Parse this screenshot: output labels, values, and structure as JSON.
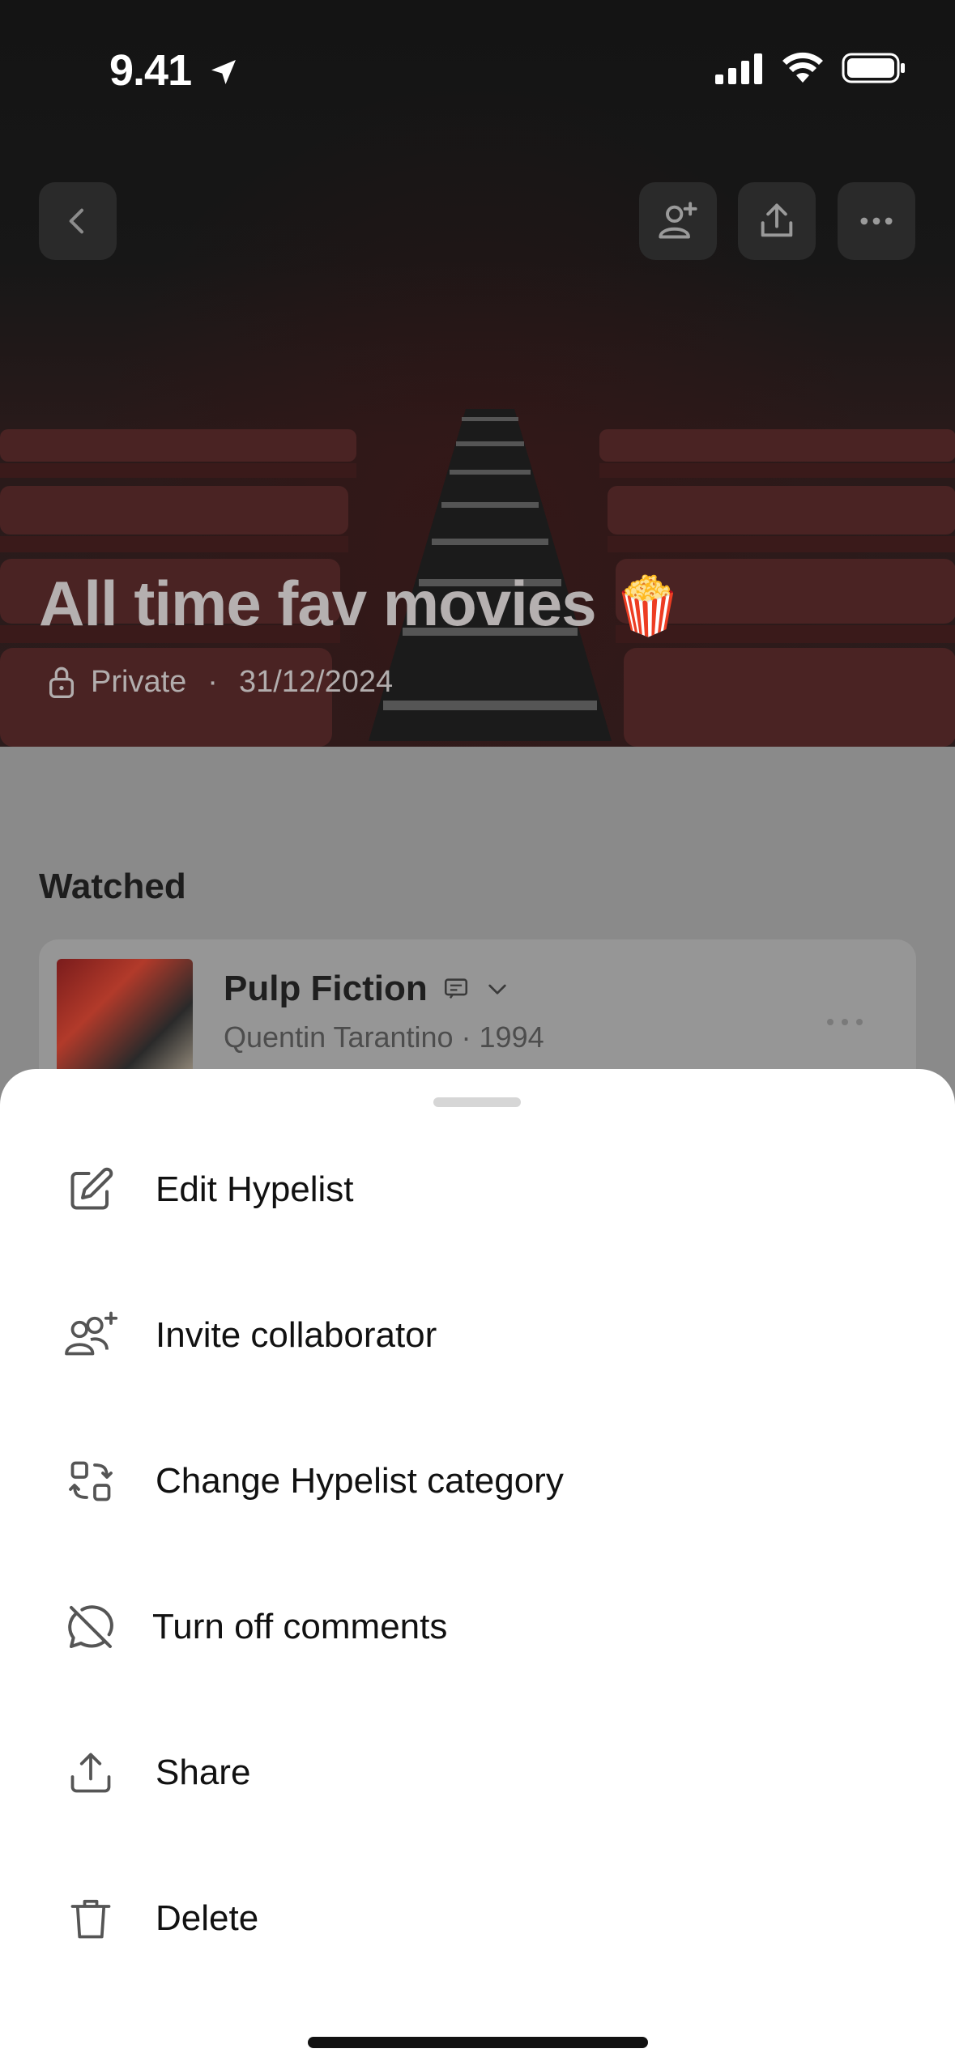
{
  "status_bar": {
    "time": "9.41"
  },
  "hero": {
    "title": "All time fav movies",
    "emoji": "🍿",
    "privacy": "Private",
    "separator": "·",
    "date": "31/12/2024"
  },
  "section": {
    "title": "Watched"
  },
  "items": [
    {
      "title": "Pulp Fiction",
      "subtitle": "Quentin Tarantino · 1994"
    }
  ],
  "menu": [
    {
      "label": "Edit Hypelist",
      "icon": "edit-icon"
    },
    {
      "label": "Invite collaborator",
      "icon": "invite-users-icon"
    },
    {
      "label": "Change Hypelist category",
      "icon": "swap-category-icon"
    },
    {
      "label": "Turn off comments",
      "icon": "comments-off-icon"
    },
    {
      "label": "Share",
      "icon": "share-icon"
    },
    {
      "label": "Delete",
      "icon": "trash-icon"
    }
  ]
}
